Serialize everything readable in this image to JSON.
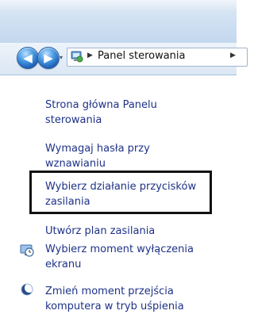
{
  "nav": {
    "back_symbol": "◀",
    "forward_symbol": "▶",
    "recent_pages_symbol": "▾"
  },
  "address_bar": {
    "icon": "control-panel-icon",
    "separator": "▶",
    "location": "Panel sterowania"
  },
  "sidebar": {
    "links": [
      {
        "line1": "Strona główna Panelu",
        "line2": "sterowania"
      },
      {
        "line1": "Wymagaj hasła przy",
        "line2": "wznawianiu"
      },
      {
        "line1": "Wybierz działanie przycisków",
        "line2": "zasilania",
        "highlighted": true
      },
      {
        "line1": "Utwórz plan zasilania",
        "line2": ""
      },
      {
        "line1": "Wybierz moment wyłączenia",
        "line2": "ekranu",
        "icon": "display-timer-icon"
      },
      {
        "line1": "Zmień moment przejścia",
        "line2": "komputera w tryb uśpienia",
        "icon": "sleep-moon-icon"
      }
    ]
  },
  "colors": {
    "link": "#1e3287",
    "highlight_border": "#111111",
    "nav_button": "#1d5fb4"
  }
}
